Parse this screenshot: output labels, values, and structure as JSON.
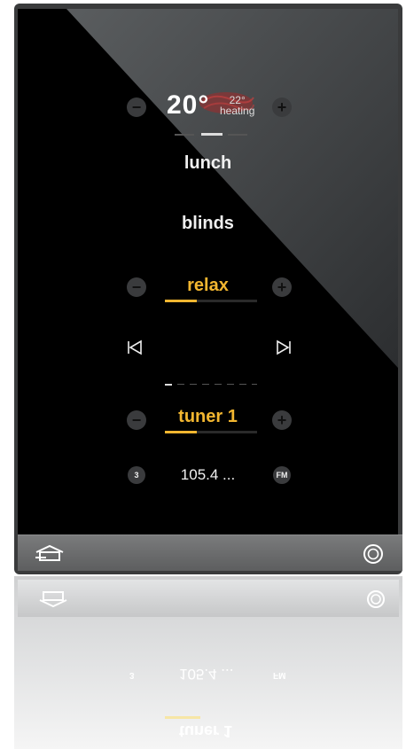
{
  "climate": {
    "current_temp": "20°",
    "setpoint": "22°",
    "mode": "heating",
    "minus": "−",
    "plus": "+"
  },
  "scenes": [
    "lunch",
    "blinds"
  ],
  "music": {
    "source": "relax",
    "volume_level": 0.35,
    "minus": "−",
    "plus": "+",
    "prev_icon": "skip-back-icon",
    "next_icon": "skip-forward-icon"
  },
  "radio": {
    "source": "tuner 1",
    "volume_level": 0.35,
    "minus": "−",
    "plus": "+",
    "preset": "3",
    "frequency": "105.4 ...",
    "band": "FM"
  },
  "bottom_bar": {
    "home_icon": "home-icon",
    "power_icon": "circle-button-icon"
  },
  "colors": {
    "accent": "#f2b630",
    "screen_bg": "#000000",
    "frame": "#3a3b3c"
  }
}
